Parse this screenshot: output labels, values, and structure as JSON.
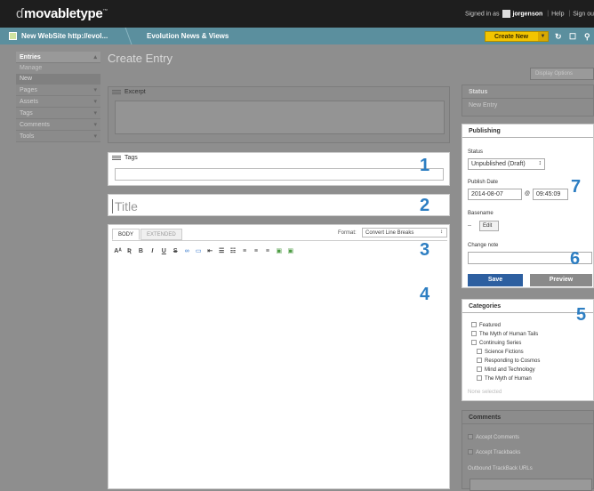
{
  "app": {
    "logo": "movabletype",
    "logo_mark": "ɗ",
    "tm": "™"
  },
  "user": {
    "signed_in_prefix": "Signed in as",
    "username": "jorgenson",
    "help": "Help",
    "sign_out": "Sign ou"
  },
  "sitebar": {
    "site_name": "New WebSite http://evol...",
    "blog_name": "Evolution News & Views",
    "create_new": "Create New",
    "icons": [
      "refresh-icon",
      "edit-icon",
      "search-icon"
    ]
  },
  "sidebar": {
    "sections": [
      {
        "label": "Entries",
        "expanded": true,
        "subitems": [
          {
            "label": "Manage",
            "current": false
          },
          {
            "label": "New",
            "current": true
          }
        ]
      },
      {
        "label": "Pages"
      },
      {
        "label": "Assets"
      },
      {
        "label": "Tags"
      },
      {
        "label": "Comments"
      },
      {
        "label": "Tools"
      }
    ]
  },
  "main": {
    "title": "Create Entry",
    "display_options": "Display Options",
    "excerpt_label": "Excerpt",
    "tags_label": "Tags",
    "title_placeholder": "Title",
    "editor": {
      "tab_body": "BODY",
      "tab_extended": "EXTENDED",
      "format_label": "Format:",
      "format_value": "Convert Line Breaks",
      "toolbar": [
        "Aᴬ",
        "Ʀ",
        "B",
        "I",
        "U",
        "S",
        "∞",
        "▭",
        "⇤",
        "☰",
        "☷",
        "≡",
        "≡",
        "≡",
        "▣",
        "▣"
      ]
    }
  },
  "right": {
    "status": {
      "heading": "Status",
      "value": "New Entry"
    },
    "publishing": {
      "heading": "Publishing",
      "status_label": "Status",
      "status_value": "Unpublished (Draft)",
      "publish_date_label": "Publish Date",
      "date": "2014-08-07",
      "at": "@",
      "time": "09:45:09",
      "basename_label": "Basename",
      "basename_value": "--",
      "edit": "Edit",
      "change_note_label": "Change note",
      "save": "Save",
      "preview": "Preview"
    },
    "categories": {
      "heading": "Categories",
      "items": [
        "Featured",
        "The Myth of Human Tails",
        "Continuing Series",
        "Science Fictions",
        "Responding to Cosmos",
        "Mind and Technology",
        "The Myth of Human"
      ],
      "none_selected": "None selected"
    },
    "comments": {
      "heading": "Comments",
      "accept_comments": "Accept Comments",
      "accept_trackbacks": "Accept Trackbacks",
      "outbound_label": "Outbound TrackBack URLs"
    }
  },
  "callouts": [
    "1",
    "2",
    "3",
    "4",
    "5",
    "6",
    "7"
  ],
  "colors": {
    "callout": "#2d7ec2",
    "sitebar": "#5b8f9e",
    "create_new": "#f2c400",
    "save": "#2d5fa0"
  }
}
